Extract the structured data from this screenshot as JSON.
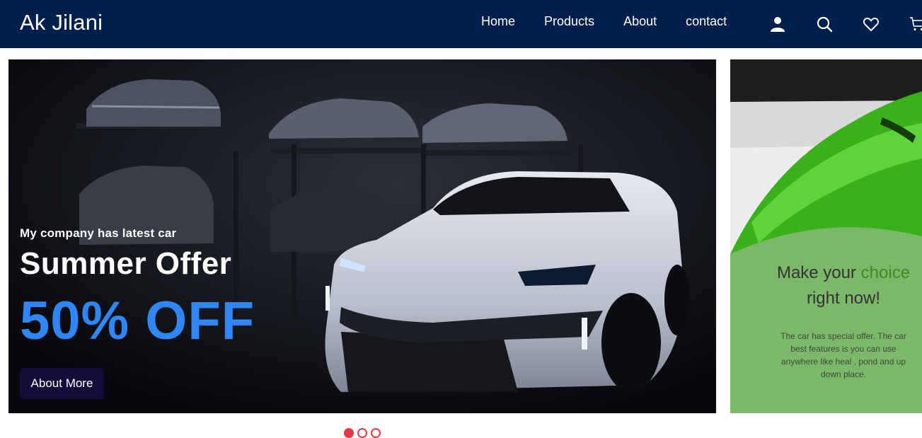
{
  "navbar": {
    "brand": "Ak Jilani",
    "links": [
      {
        "label": "Home"
      },
      {
        "label": "Products"
      },
      {
        "label": "About"
      },
      {
        "label": "contact"
      }
    ],
    "icons": [
      "user-icon",
      "search-icon",
      "heart-icon",
      "cart-icon"
    ]
  },
  "hero": {
    "subtitle": "My company has latest car",
    "title": "Summer Offer",
    "offer": "50% OFF",
    "button_label": "About More"
  },
  "side_card": {
    "title_prefix": "Make your ",
    "title_highlight": "choice",
    "title_suffix": "right now!",
    "description": "The car has special offer. The car best features is you can use anywhere like heal , pond and up down place."
  },
  "carousel": {
    "active_index": 0,
    "dot_count": 3
  },
  "colors": {
    "navbar_bg": "#011f4b",
    "offer_blue": "#2f86f6",
    "button_bg": "#130d3a",
    "side_card_green": "#7bb86a",
    "highlight_green": "#3e8a1f",
    "dot_red": "#e63946"
  }
}
